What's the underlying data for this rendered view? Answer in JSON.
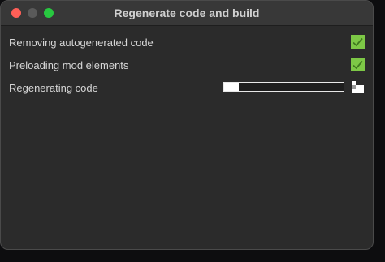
{
  "window": {
    "title": "Regenerate code and build"
  },
  "tasks": [
    {
      "label": "Removing autogenerated code",
      "status": "done",
      "icon": "checkmark-icon"
    },
    {
      "label": "Preloading mod elements",
      "status": "done",
      "icon": "checkmark-icon"
    },
    {
      "label": "Regenerating code",
      "status": "in-progress",
      "progress": 0.12,
      "icon": "loading-icon"
    }
  ],
  "colors": {
    "check_bg": "#7dc846",
    "window_bg": "#2b2b2b",
    "titlebar_bg": "#383838"
  }
}
